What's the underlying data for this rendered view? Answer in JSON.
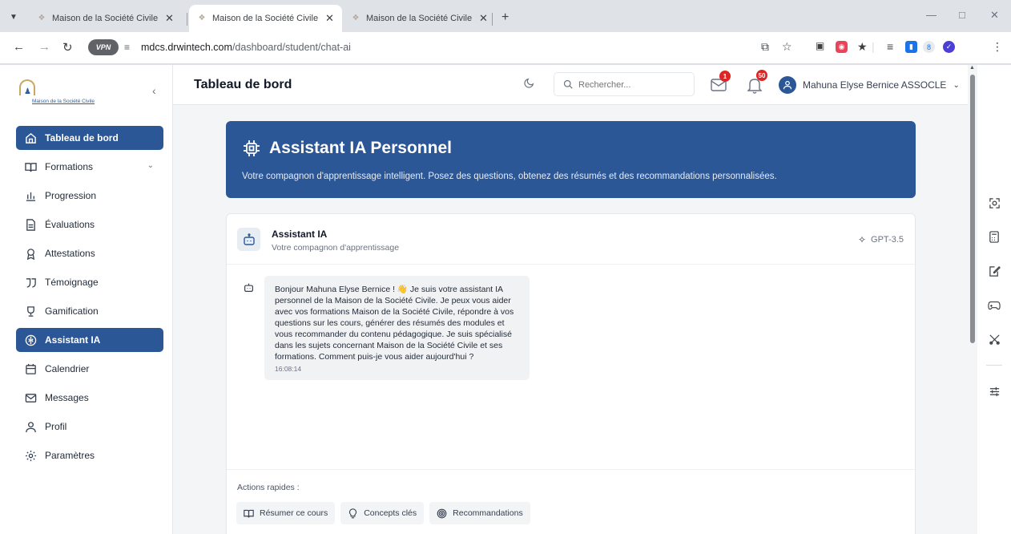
{
  "browser": {
    "tabs": [
      {
        "title": "Maison de la Société Civile - Pla",
        "active": false
      },
      {
        "title": "Maison de la Société Civile - Pla",
        "active": true
      },
      {
        "title": "Maison de la Société Civile - Pla",
        "active": false
      }
    ],
    "vpn_label": "VPN",
    "url_host": "mdcs.drwintech.com",
    "url_path": "/dashboard/student/chat-ai"
  },
  "sidebar": {
    "logo_text": "Maison de la Société Civile",
    "items": [
      {
        "label": "Tableau de bord",
        "icon": "home-icon",
        "active": true
      },
      {
        "label": "Formations",
        "icon": "book-icon",
        "active": false,
        "has_dropdown": true
      },
      {
        "label": "Progression",
        "icon": "bar-chart-icon",
        "active": false
      },
      {
        "label": "Évaluations",
        "icon": "document-icon",
        "active": false
      },
      {
        "label": "Attestations",
        "icon": "award-icon",
        "active": false
      },
      {
        "label": "Témoignage",
        "icon": "quote-icon",
        "active": false
      },
      {
        "label": "Gamification",
        "icon": "trophy-icon",
        "active": false
      },
      {
        "label": "Assistant IA",
        "icon": "brain-icon",
        "active": true
      },
      {
        "label": "Calendrier",
        "icon": "calendar-icon",
        "active": false
      },
      {
        "label": "Messages",
        "icon": "mail-icon",
        "active": false
      },
      {
        "label": "Profil",
        "icon": "user-icon",
        "active": false
      },
      {
        "label": "Paramètres",
        "icon": "settings-icon",
        "active": false
      }
    ]
  },
  "header": {
    "title": "Tableau de bord",
    "search_placeholder": "Rechercher...",
    "mail_count": "1",
    "notif_count": "50",
    "user_name": "Mahuna Elyse Bernice ASSOCLE"
  },
  "hero": {
    "title": "Assistant IA Personnel",
    "subtitle": "Votre compagnon d'apprentissage intelligent. Posez des questions, obtenez des résumés et des recommandations personnalisées."
  },
  "chat": {
    "assistant_name": "Assistant IA",
    "assistant_sub": "Votre compagnon d'apprentissage",
    "model": "GPT-3.5",
    "messages": [
      {
        "text_before": "Bonjour Mahuna Elyse Bernice ! ",
        "emoji": "👋",
        "text_after": " Je suis votre assistant IA personnel de la Maison de la Société Civile. Je peux vous aider avec vos formations Maison de la Société Civile, répondre à vos questions sur les cours, générer des résumés des modules et vous recommander du contenu pédagogique. Je suis spécialisé dans les sujets concernant Maison de la Société Civile et ses formations. Comment puis-je vous aider aujourd'hui ?",
        "time": "16:08:14"
      }
    ],
    "quick_actions_label": "Actions rapides :",
    "quick_actions": [
      {
        "label": "Résumer ce cours",
        "icon": "book-open-icon"
      },
      {
        "label": "Concepts clés",
        "icon": "lightbulb-icon"
      },
      {
        "label": "Recommandations",
        "icon": "target-icon"
      }
    ]
  },
  "colors": {
    "primary": "#2b5797",
    "badge": "#dc2626",
    "page_bg": "#f4f5f7"
  }
}
